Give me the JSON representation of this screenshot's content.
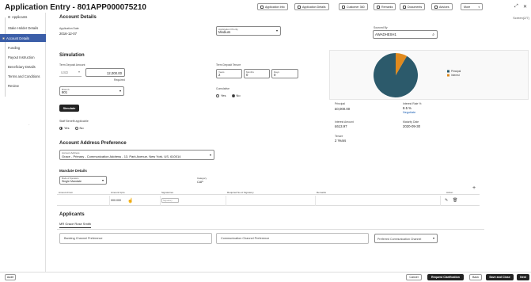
{
  "header": {
    "title": "Application Entry - 801APP000075210",
    "buttons": [
      "Application Info",
      "Application Details",
      "Customer 360",
      "Remarks",
      "Documents",
      "Advices",
      "More"
    ],
    "screen_id": "Screen(2/7)"
  },
  "sidebar": {
    "items": [
      "Applicants",
      "Stake Holder Details",
      "Account Details",
      "Funding",
      "Payout Instruction",
      "Beneficiary Details",
      "Terms and Conditions",
      "Review"
    ]
  },
  "account_details": {
    "title": "Account Details",
    "app_date_label": "Application Date",
    "app_date_value": "2016-12-07",
    "priority_label": "Application Priority",
    "priority_value": "Medium",
    "sourced_by_label": "Sourced By",
    "sourced_by_value": "AWADHESH1"
  },
  "simulation": {
    "title": "Simulation",
    "deposit_amount_label": "Term Deposit Amount",
    "currency": "USD",
    "amount": "12,000.00",
    "required": "Required",
    "tenure_label": "Term Deposit Tenure",
    "tenure_years_label": "Years",
    "tenure_years": "2",
    "tenure_months_label": "Months",
    "tenure_months": "0",
    "tenure_days_label": "Days",
    "tenure_days": "0",
    "branch_label": "Branch",
    "branch_value": "801",
    "cumulative_label": "Cumulative",
    "yes": "Yes",
    "no": "No",
    "simulate_btn": "Simulate",
    "staff_label": "Staff Benefit applicable"
  },
  "chart_data": {
    "type": "pie",
    "labels": [
      "Principal",
      "Interest"
    ],
    "values": [
      91.6,
      8.4
    ],
    "colors": [
      "#2c5a6b",
      "#e08a1e"
    ]
  },
  "summary": {
    "principal_label": "Principal",
    "principal_value": "£0,000.00",
    "rate_label": "Interest Rate %",
    "rate_value": "8.5 %",
    "negotiate": "Negotiate",
    "interest_amount_label": "Interest Amount",
    "interest_amount_value": "£613.97",
    "maturity_label": "Maturity Date",
    "maturity_value": "2020-09-30",
    "tenure_label": "Tenure",
    "tenure_value": "2 Years"
  },
  "address": {
    "title": "Account Address Preference",
    "label": "Account Address",
    "value": "Grace - Primary - Communication Address - 13, Park Avenue, New York, US, 610014"
  },
  "mandate": {
    "title": "Mandate Details",
    "mode_label": "Mode of Operation",
    "mode_value": "Single Mandate",
    "category_label": "Category",
    "category_value": "CAP",
    "columns": [
      "Amount From",
      "Amount Upto",
      "Signatories",
      "Required No.of Signatory",
      "Remarks",
      "Action"
    ],
    "row_amount_upto": "000.000",
    "row_signatory_placeholder": "Signatory"
  },
  "applicants": {
    "title": "Applicants",
    "tab": "MR Grace Rose Smith",
    "banking_pref": "Banking Channel Preference",
    "comm_pref": "Communication Channel Preference",
    "pref_comm": "Preferred Communication Channel"
  },
  "footer": {
    "audit": "Audit",
    "cancel": "Cancel",
    "request_clarification": "Request Clarification",
    "back": "Back",
    "save_close": "Save and Close",
    "next": "Next"
  }
}
